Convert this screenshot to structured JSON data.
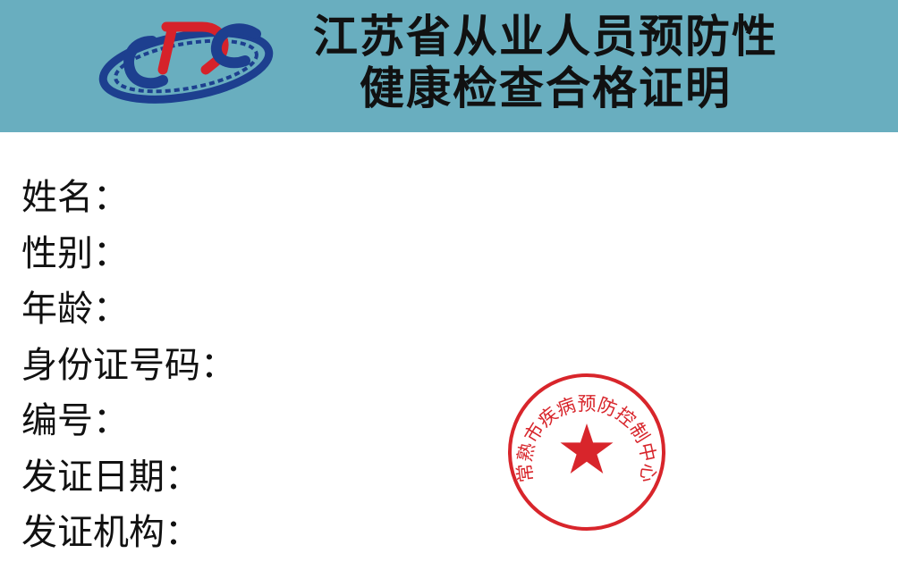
{
  "header": {
    "logo_text": "CDC",
    "title_line1": "江苏省从业人员预防性",
    "title_line2": "健康检查合格证明"
  },
  "fields": [
    {
      "label": "姓名："
    },
    {
      "label": "性别："
    },
    {
      "label": "年龄："
    },
    {
      "label": "身份证号码："
    },
    {
      "label": "编号："
    },
    {
      "label": "发证日期："
    },
    {
      "label": "发证机构："
    }
  ],
  "seal": {
    "text": "常熟市疾病预防控制中心"
  },
  "colors": {
    "header_bg": "#69aebf",
    "logo_blue": "#1d3f8f",
    "logo_red": "#d6222a",
    "seal_red": "#d8252b"
  }
}
